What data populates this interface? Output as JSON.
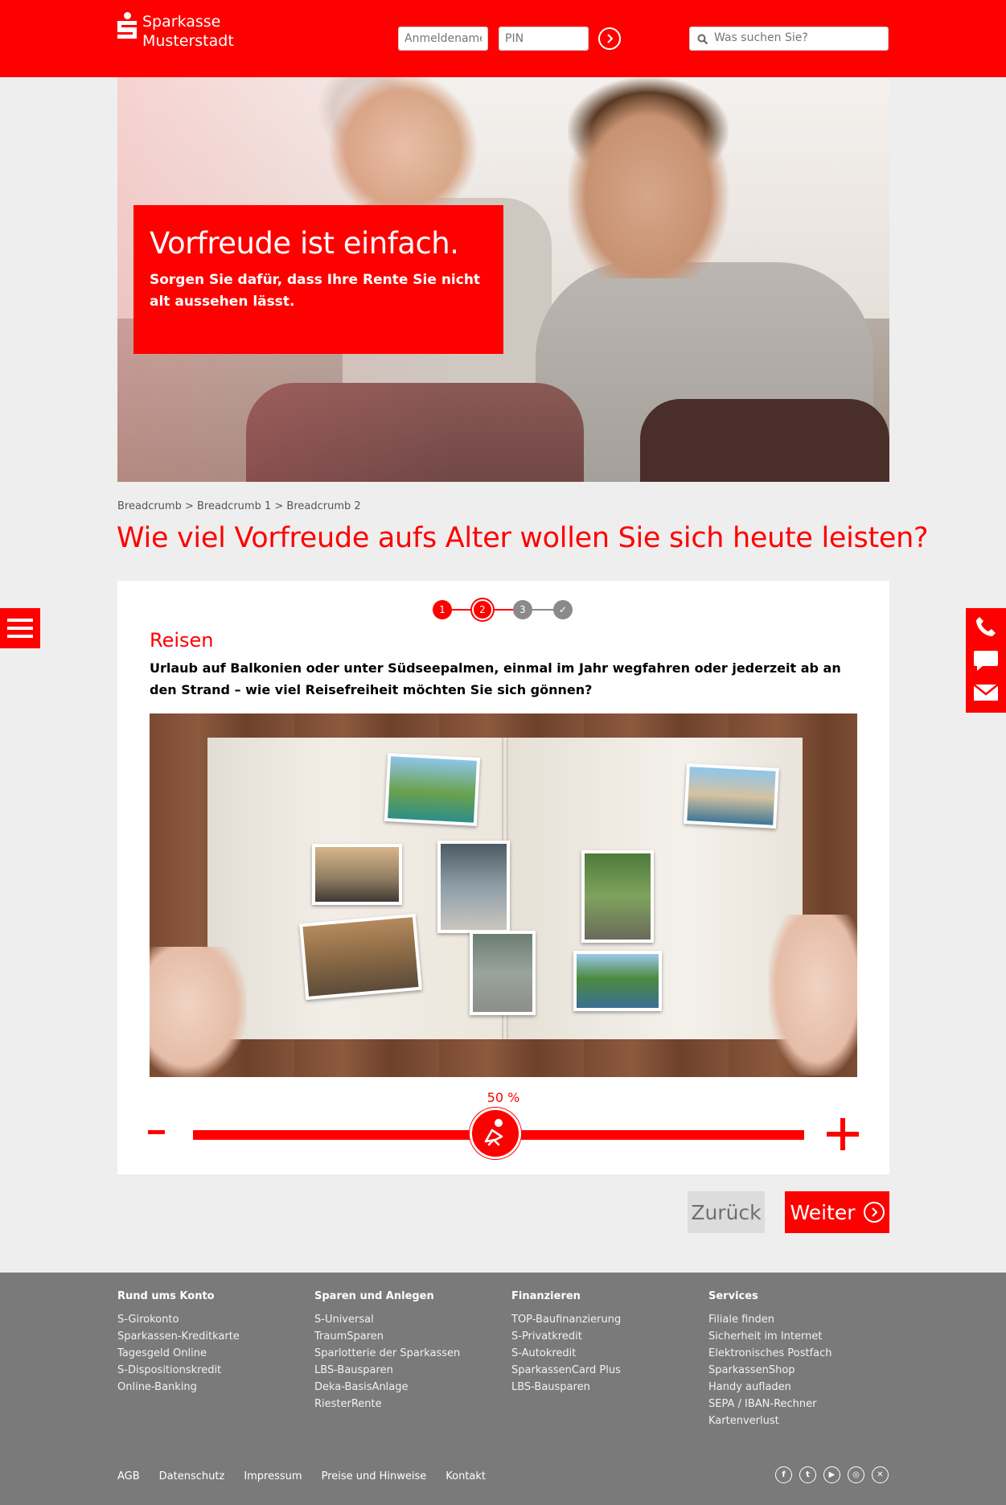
{
  "header": {
    "brand_line1": "Sparkasse",
    "brand_line2": "Musterstadt",
    "login_placeholder": "Anmeldename",
    "pin_placeholder": "PIN",
    "search_placeholder": "Was suchen Sie?"
  },
  "hero": {
    "title": "Vorfreude ist einfach.",
    "subtitle": "Sorgen Sie dafür, dass Ihre Rente Sie nicht alt aussehen lässt."
  },
  "breadcrumb": "Breadcrumb > Breadcrumb 1 > Breadcrumb 2",
  "page_title": "Wie viel Vorfreude aufs Alter wollen Sie sich heute leisten?",
  "steps": [
    "1",
    "2",
    "3",
    "✓"
  ],
  "current_step": 2,
  "section": {
    "title": "Reisen",
    "text": "Urlaub auf Balkonien oder unter Südseepalmen, einmal im Jahr wegfahren oder jederzeit ab an den Strand – wie viel Reisefreiheit möchten Sie sich gönnen?"
  },
  "slider": {
    "value_label": "50 %",
    "value": 50,
    "minus": "-",
    "plus": "+"
  },
  "buttons": {
    "back": "Zurück",
    "next": "Weiter"
  },
  "footer": {
    "columns": [
      {
        "title": "Rund ums Konto",
        "items": [
          "S-Girokonto",
          "Sparkassen-Kreditkarte",
          "Tagesgeld Online",
          "S-Dispositionskredit",
          "Online-Banking"
        ]
      },
      {
        "title": "Sparen und Anlegen",
        "items": [
          "S-Universal",
          "TraumSparen",
          "Sparlotterie der Sparkassen",
          "LBS-Bausparen",
          "Deka-BasisAnlage",
          "RiesterRente"
        ]
      },
      {
        "title": "Finanzieren",
        "items": [
          "TOP-Baufinanzierung",
          "S-Privatkredit",
          "S-Autokredit",
          "SparkassenCard Plus",
          "LBS-Bausparen"
        ]
      },
      {
        "title": "Services",
        "items": [
          "Filiale finden",
          "Sicherheit im Internet",
          "Elektronisches Postfach",
          "SparkassenShop",
          "Handy aufladen",
          "SEPA / IBAN-Rechner",
          "Kartenverlust"
        ]
      }
    ],
    "links": [
      "AGB",
      "Datenschutz",
      "Impressum",
      "Preise und Hinweise",
      "Kontakt"
    ],
    "social": [
      "facebook-icon",
      "twitter-icon",
      "youtube-icon",
      "instagram-icon",
      "xing-icon"
    ]
  },
  "colors": {
    "brand_red": "#ff0000",
    "footer_gray": "#7a7a7a",
    "page_bg": "#efeeee"
  }
}
